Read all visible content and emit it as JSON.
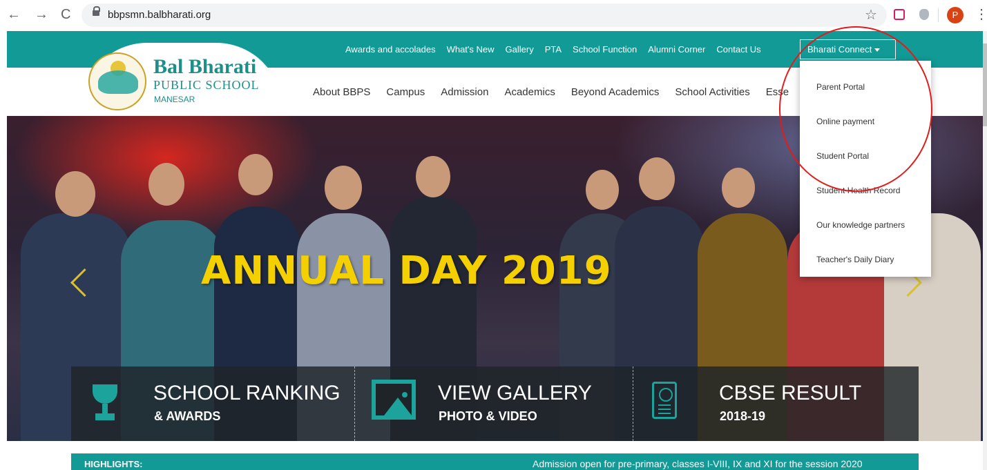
{
  "browser": {
    "url": "bbpsmn.balbharati.org",
    "profile_initial": "P",
    "icons": [
      "back-icon",
      "forward-icon",
      "reload-icon",
      "lock-icon",
      "star-icon",
      "extension-icon",
      "menu-icon"
    ],
    "back_glyph": "←",
    "forward_glyph": "→",
    "reload_glyph": "C",
    "star_glyph": "☆",
    "kebab_glyph": "⋮"
  },
  "site": {
    "brand_name": "Bal Bharati",
    "brand_sub": "PUBLIC SCHOOL",
    "brand_location": "MANESAR",
    "colors": {
      "primary": "#119a96",
      "hero_title": "#f5d000",
      "highlight_ring": "#e21b1b"
    }
  },
  "top_nav": [
    "Awards and accolades",
    "What's New",
    "Gallery",
    "PTA",
    "School Function",
    "Alumni Corner",
    "Contact Us"
  ],
  "bharati_connect": {
    "label": "Bharati Connect",
    "items": [
      "Parent Portal",
      "Online payment",
      "Student Portal",
      "Student Health Record",
      "Our knowledge partners",
      "Teacher's Daily Diary"
    ]
  },
  "main_nav": [
    "About BBPS",
    "Campus",
    "Admission",
    "Academics",
    "Beyond Academics",
    "School Activities",
    "Esse"
  ],
  "hero": {
    "title": "ANNUAL DAY 2019"
  },
  "quick_links": [
    {
      "title": "SCHOOL RANKING",
      "subtitle": "& AWARDS",
      "icon": "trophy-icon"
    },
    {
      "title": "VIEW GALLERY",
      "subtitle": "PHOTO & VIDEO",
      "icon": "photo-icon"
    },
    {
      "title": "CBSE RESULT",
      "subtitle": "2018-19",
      "icon": "certificate-icon"
    }
  ],
  "highlights": {
    "label": "HIGHLIGHTS:",
    "text": "Admission open for pre-primary, classes I-VIII, IX and XI for the session 2020"
  }
}
